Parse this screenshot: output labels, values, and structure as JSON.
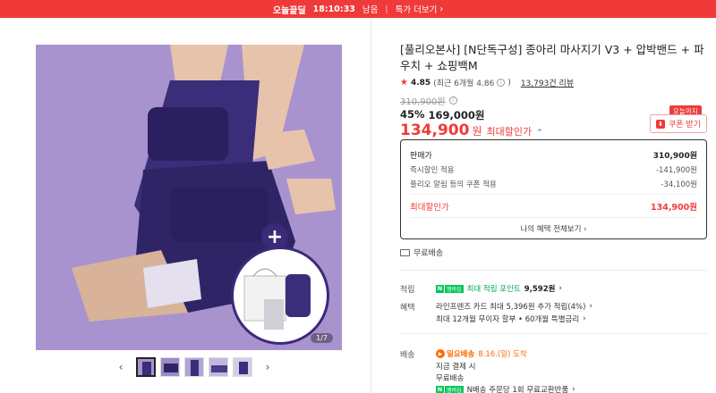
{
  "topbar": {
    "brand": "오늘끝딜",
    "time": "18:10:33",
    "time_suffix": "남음",
    "more_label": "특가 더보기"
  },
  "gallery": {
    "counter": "1/7",
    "thumb_count": 5
  },
  "product": {
    "title": "[풀리오본사] [N단독구성] 종아리 마사지기 V3 + 압박밴드 + 파우치 + 쇼핑백M",
    "rating": "4.85",
    "rating_detail": "(최근 6개월 4.86",
    "rating_detail_end": ")",
    "review_count": "13,793건 리뷰",
    "original_price": "310,900원",
    "discount_pct": "45%",
    "discount_price": "169,000원",
    "final_amount": "134,900",
    "final_unit": "원",
    "final_label": "최대할인가"
  },
  "coupon": {
    "tag": "오늘까지",
    "button_label": "쿠폰 받기"
  },
  "price_box": {
    "rows": [
      {
        "k": "판매가",
        "v": "310,900원"
      },
      {
        "k": "즉시할인 적용",
        "v": "-141,900원"
      },
      {
        "k": "풀리오 알림 등의 쿠폰 적용",
        "v": "-34,100원"
      }
    ],
    "max_label": "최대할인가",
    "max_value": "134,900원",
    "all_benefits": "나의 혜택 전체보기"
  },
  "shipping_free": "무료배송",
  "sections": {
    "points_label": "적립",
    "points_text": "최대 적립 포인트",
    "points_amount": "9,592원",
    "benefit_label": "혜택",
    "benefit_line1": "라인프렌즈 카드 최대 5,396원 추가 적립(4%)",
    "benefit_line2": "최대 12개월 무이자 할부 • 60개월 특별금리",
    "delivery_label": "배송",
    "delivery_badge": "일요배송",
    "delivery_date": "8.16.(일) 도착",
    "delivery_line2": "지금 결제 시",
    "delivery_line3": "무료배송",
    "delivery_line4": "N배송 주문당 1회 무료교환반품",
    "npay_mark": "멤버십"
  },
  "colors": {
    "accent_red": "#f03a3a",
    "naver_green": "#03c75a",
    "orange": "#ff6a00",
    "image_bg": "#a993cf"
  }
}
